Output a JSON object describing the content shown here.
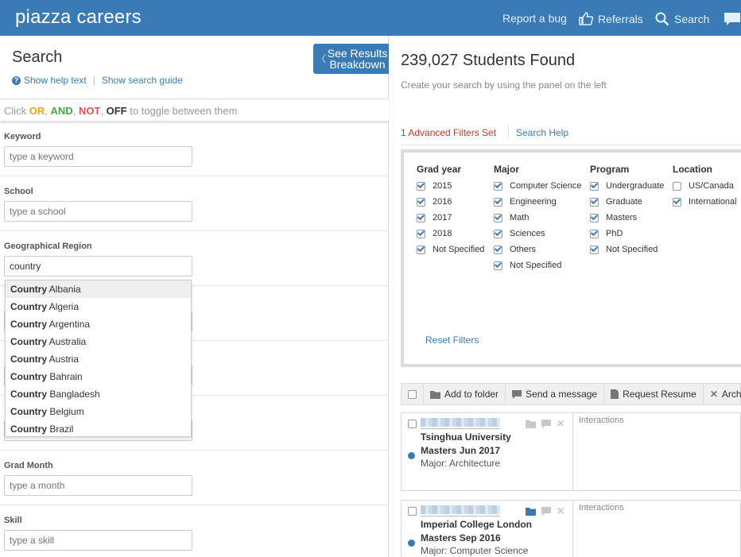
{
  "header": {
    "brand": "piazza careers",
    "nav": {
      "report_bug": "Report a bug",
      "referrals": "Referrals",
      "search": "Search"
    }
  },
  "left": {
    "title": "Search",
    "show_help": "Show help text",
    "show_guide": "Show search guide",
    "see_results_line1": "See Results",
    "see_results_line2": "Breakdown",
    "toggle": {
      "prefix": "Click",
      "or": "OR",
      "and": "AND",
      "not": "NOT",
      "off": "OFF",
      "suffix": "to toggle between them"
    },
    "fields": {
      "keyword": {
        "label": "Keyword",
        "placeholder": "type a keyword"
      },
      "school": {
        "label": "School",
        "placeholder": "type a school"
      },
      "region": {
        "label": "Geographical Region",
        "value": "country"
      },
      "grad_month": {
        "label": "Grad Month",
        "placeholder": "type a month"
      },
      "skill": {
        "label": "Skill",
        "placeholder": "type a skill"
      }
    },
    "dropdown": [
      {
        "prefix": "Country",
        "name": "Albania"
      },
      {
        "prefix": "Country",
        "name": "Algeria"
      },
      {
        "prefix": "Country",
        "name": "Argentina"
      },
      {
        "prefix": "Country",
        "name": "Australia"
      },
      {
        "prefix": "Country",
        "name": "Austria"
      },
      {
        "prefix": "Country",
        "name": "Bahrain"
      },
      {
        "prefix": "Country",
        "name": "Bangladesh"
      },
      {
        "prefix": "Country",
        "name": "Belgium"
      },
      {
        "prefix": "Country",
        "name": "Brazil"
      }
    ]
  },
  "right": {
    "found": "239,027 Students Found",
    "subtitle": "Create your search by using the panel on the left",
    "filters_set": "1 Advanced Filters Set",
    "search_help": "Search Help",
    "filters": {
      "grad_year": {
        "title": "Grad year",
        "options": [
          {
            "label": "2015",
            "checked": true
          },
          {
            "label": "2016",
            "checked": true
          },
          {
            "label": "2017",
            "checked": true
          },
          {
            "label": "2018",
            "checked": true
          },
          {
            "label": "Not Specified",
            "checked": true
          }
        ]
      },
      "major": {
        "title": "Major",
        "options": [
          {
            "label": "Computer Science",
            "checked": true
          },
          {
            "label": "Engineering",
            "checked": true
          },
          {
            "label": "Math",
            "checked": true
          },
          {
            "label": "Sciences",
            "checked": true
          },
          {
            "label": "Others",
            "checked": true
          },
          {
            "label": "Not Specified",
            "checked": true
          }
        ]
      },
      "program": {
        "title": "Program",
        "options": [
          {
            "label": "Undergraduate",
            "checked": true
          },
          {
            "label": "Graduate",
            "checked": true
          },
          {
            "label": "Masters",
            "checked": true
          },
          {
            "label": "PhD",
            "checked": true
          },
          {
            "label": "Not Specified",
            "checked": true
          }
        ]
      },
      "location": {
        "title": "Location",
        "options": [
          {
            "label": "US/Canada",
            "checked": false
          },
          {
            "label": "International",
            "checked": true
          }
        ]
      }
    },
    "reset": "Reset Filters",
    "toolbar": {
      "add_folder": "Add to folder",
      "send_message": "Send a message",
      "request_resume": "Request Resume",
      "archive": "Archi"
    },
    "students": [
      {
        "school": "Tsinghua University",
        "program": "Masters Jun 2017",
        "major": "Major: Architecture",
        "interactions": "Interactions"
      },
      {
        "school": "Imperial College London",
        "program": "Masters Sep 2016",
        "major": "Major: Computer Science",
        "interactions": "Interactions"
      }
    ]
  },
  "colors": {
    "brand": "#3a7ab5",
    "alert": "#c0392b"
  }
}
